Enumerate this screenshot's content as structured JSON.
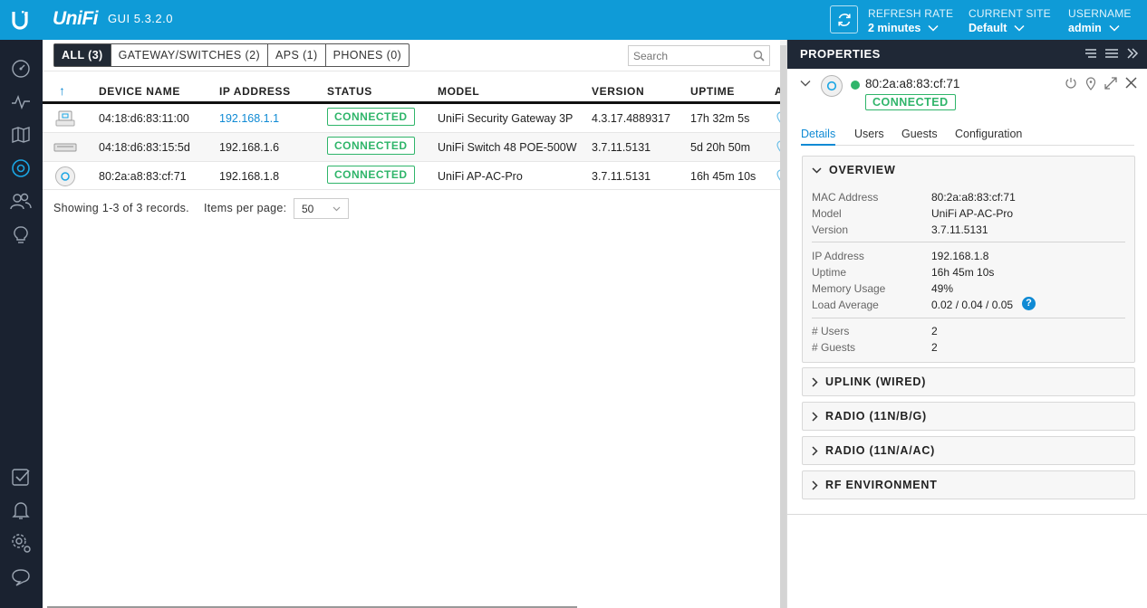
{
  "topbar": {
    "brand": "UniFi",
    "gui_version": "GUI 5.3.2.0",
    "refresh_rate": {
      "label": "REFRESH RATE",
      "value": "2 minutes"
    },
    "current_site": {
      "label": "CURRENT SITE",
      "value": "Default"
    },
    "username": {
      "label": "USERNAME",
      "value": "admin"
    },
    "accent_color": "#0f9bd7"
  },
  "nav": {
    "items": [
      "dashboard-icon",
      "statistics-icon",
      "map-icon",
      "devices-icon",
      "clients-icon",
      "insights-icon",
      "events-icon",
      "alerts-icon",
      "settings-icon",
      "chat-icon"
    ]
  },
  "filters": [
    {
      "label": "ALL (3)",
      "active": true
    },
    {
      "label": "GATEWAY/SWITCHES (2)",
      "active": false
    },
    {
      "label": "APS (1)",
      "active": false
    },
    {
      "label": "PHONES (0)",
      "active": false
    }
  ],
  "search": {
    "placeholder": "Search"
  },
  "table": {
    "sort_arrow": "↑",
    "columns": [
      "DEVICE NAME",
      "IP ADDRESS",
      "STATUS",
      "MODEL",
      "VERSION",
      "UPTIME",
      "AC"
    ],
    "rows": [
      {
        "name": "04:18:d6:83:11:00",
        "ip": "192.168.1.1",
        "status": "CONNECTED",
        "model": "UniFi Security Gateway 3P",
        "version": "4.3.17.4889317",
        "uptime": "17h 32m 5s"
      },
      {
        "name": "04:18:d6:83:15:5d",
        "ip": "192.168.1.6",
        "status": "CONNECTED",
        "model": "UniFi Switch 48 POE-500W",
        "version": "3.7.11.5131",
        "uptime": "5d 20h 50m"
      },
      {
        "name": "80:2a:a8:83:cf:71",
        "ip": "192.168.1.8",
        "status": "CONNECTED",
        "model": "UniFi AP-AC-Pro",
        "version": "3.7.11.5131",
        "uptime": "16h 45m 10s"
      }
    ]
  },
  "footer": {
    "showing": "Showing 1-3 of 3 records.",
    "per_page_label": "Items per page:",
    "per_page_value": "50"
  },
  "properties": {
    "title": "PROPERTIES",
    "device_mac": "80:2a:a8:83:cf:71",
    "status": "CONNECTED",
    "status_color": "#2fb56a",
    "tabs": [
      "Details",
      "Users",
      "Guests",
      "Configuration"
    ],
    "overview": {
      "title": "OVERVIEW",
      "group1": [
        {
          "k": "MAC Address",
          "v": "80:2a:a8:83:cf:71"
        },
        {
          "k": "Model",
          "v": "UniFi AP-AC-Pro"
        },
        {
          "k": "Version",
          "v": "3.7.11.5131"
        }
      ],
      "group2": [
        {
          "k": "IP Address",
          "v": "192.168.1.8"
        },
        {
          "k": "Uptime",
          "v": "16h 45m 10s"
        },
        {
          "k": "Memory Usage",
          "v": "49%"
        },
        {
          "k": "Load Average",
          "v": "0.02 / 0.04 / 0.05"
        }
      ],
      "group3": [
        {
          "k": "# Users",
          "v": "2"
        },
        {
          "k": "# Guests",
          "v": "2"
        }
      ],
      "help": "?"
    },
    "sections": [
      "UPLINK (WIRED)",
      "RADIO (11N/B/G)",
      "RADIO (11N/A/AC)",
      "RF ENVIRONMENT"
    ]
  }
}
